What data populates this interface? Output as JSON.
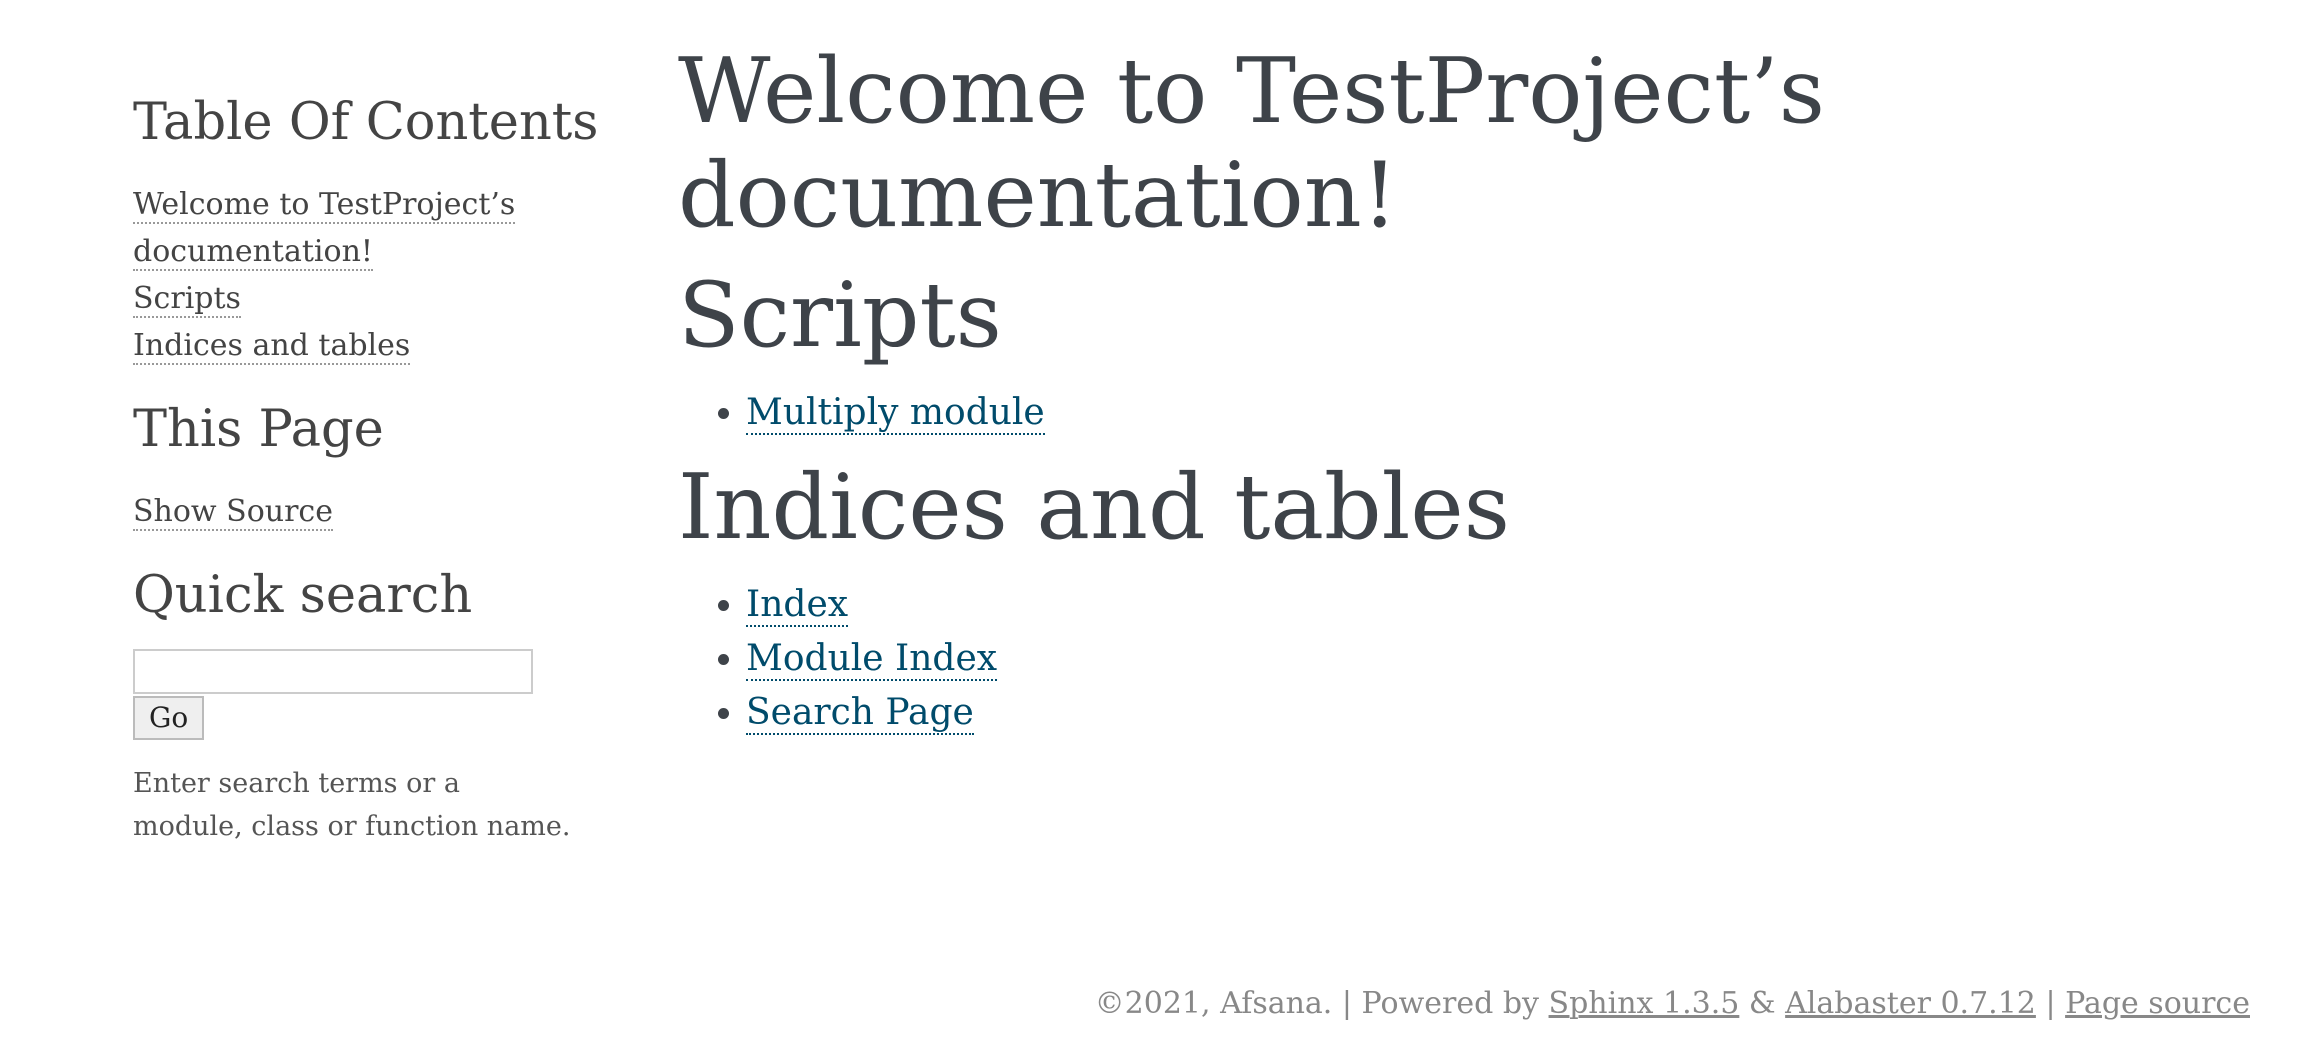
{
  "sidebar": {
    "toc_heading": "Table Of Contents",
    "toc_items": [
      {
        "label": "Welcome to TestProject’s documentation!"
      },
      {
        "label": "Scripts"
      },
      {
        "label": "Indices and tables"
      }
    ],
    "this_page_heading": "This Page",
    "show_source_label": "Show Source",
    "quick_search_heading": "Quick search",
    "search_value": "",
    "go_label": "Go",
    "search_help": "Enter search terms or a module, class or function name."
  },
  "main": {
    "title": "Welcome to TestProject’s documentation!",
    "scripts_heading": "Scripts",
    "scripts_links": [
      {
        "label": "Multiply module"
      }
    ],
    "indices_heading": "Indices and tables",
    "indices_links": [
      {
        "label": "Index"
      },
      {
        "label": "Module Index"
      },
      {
        "label": "Search Page"
      }
    ]
  },
  "footer": {
    "copyright": "©2021, Afsana.",
    "separator1": "|",
    "powered_by": "Powered by",
    "sphinx_link": "Sphinx 1.3.5",
    "ampersand": "&",
    "alabaster_link": "Alabaster 0.7.12",
    "separator2": "|",
    "page_source_link": "Page source"
  }
}
